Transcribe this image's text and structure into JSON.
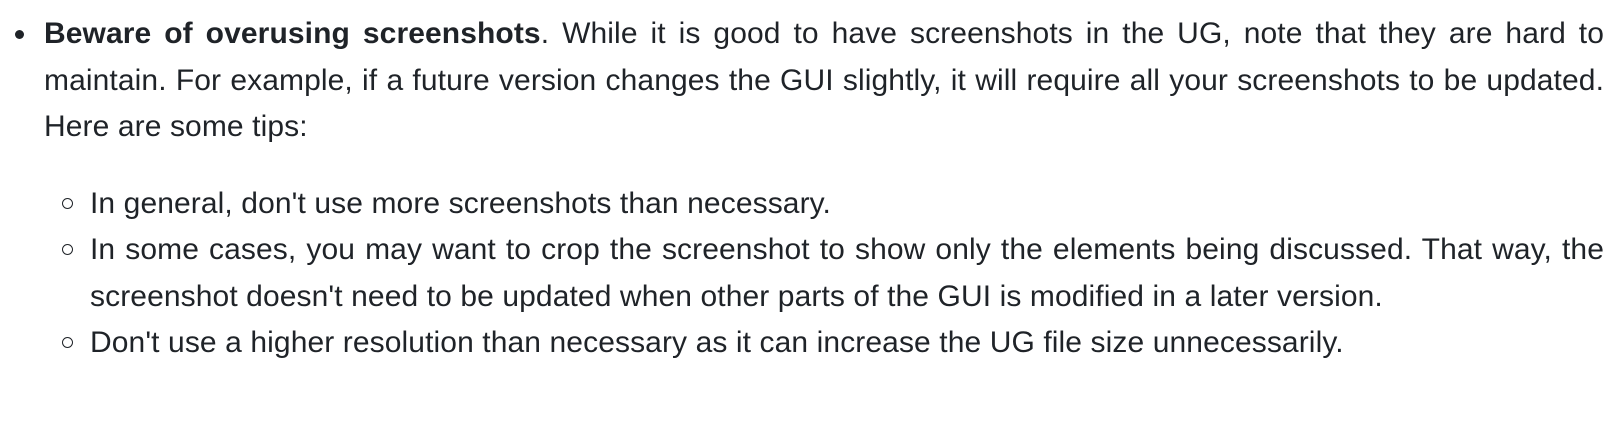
{
  "item": {
    "bold_lead": "Beware of overusing screenshots",
    "text": ". While it is good to have screenshots in the UG, note that they are hard to maintain. For example, if a future version changes the GUI slightly, it will require all your screenshots to be updated. Here are some tips:"
  },
  "tips": [
    "In general, don't use more screenshots than necessary.",
    "In some cases, you may want to crop the screenshot to show only the elements being discussed. That way, the screenshot doesn't need to be updated when other parts of the GUI is modified in a later version.",
    "Don't use a higher resolution than necessary as it can increase the UG file size unnecessarily."
  ]
}
